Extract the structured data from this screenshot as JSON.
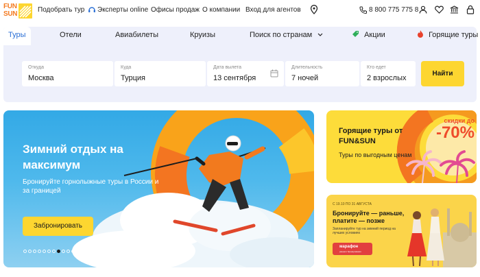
{
  "brand": {
    "line1": "FUN",
    "line2": "SUN",
    "color": "#f47a20"
  },
  "topnav": {
    "pick_tour": "Подобрать тур",
    "experts": "Эксперты online",
    "offices": "Офисы продаж",
    "about": "О компании",
    "agents_login": "Вход для агентов",
    "phone": "8 800 775 775 8"
  },
  "tabs": [
    {
      "label": "Туры",
      "active": true
    },
    {
      "label": "Отели"
    },
    {
      "label": "Авиабилеты"
    },
    {
      "label": "Круизы"
    },
    {
      "label": "Поиск по странам"
    },
    {
      "label": "Акции"
    },
    {
      "label": "Горящие туры"
    }
  ],
  "search": {
    "from_label": "Откуда",
    "from_value": "Москва",
    "to_label": "Куда",
    "to_value": "Турция",
    "date_label": "Дата вылета",
    "date_value": "13 сентября",
    "duration_label": "Длительность",
    "duration_value": "7 ночей",
    "guests_label": "Кто едет",
    "guests_value": "2  взрослых",
    "submit": "Найти"
  },
  "hero": {
    "title": "Зимний отдых на максимум",
    "subtitle": "Бронируйте горнолыжные туры в России и за границей",
    "button": "Забронировать",
    "slide_count": 24,
    "active_slide": 7
  },
  "promo_hot": {
    "title": "Горящие туры от FUN&SUN",
    "subtitle": "Туры по выгодным ценам",
    "discount_caption": "скидки до",
    "discount_value": "-70%"
  },
  "promo_early": {
    "date": "С 19.10 ПО 31 АВГУСТА",
    "title": "Бронируйте — раньше, платите — позже",
    "subtitle": "Запланируйте тур на зимний период на лучших условиях",
    "badge_title": "марафон",
    "badge_sub": "раннего бронирования"
  },
  "colors": {
    "accent_yellow": "#fdd630",
    "active_tab": "#2a6fd6",
    "panel_bg": "#eef0fb",
    "discount_red": "#ef4b2a"
  }
}
